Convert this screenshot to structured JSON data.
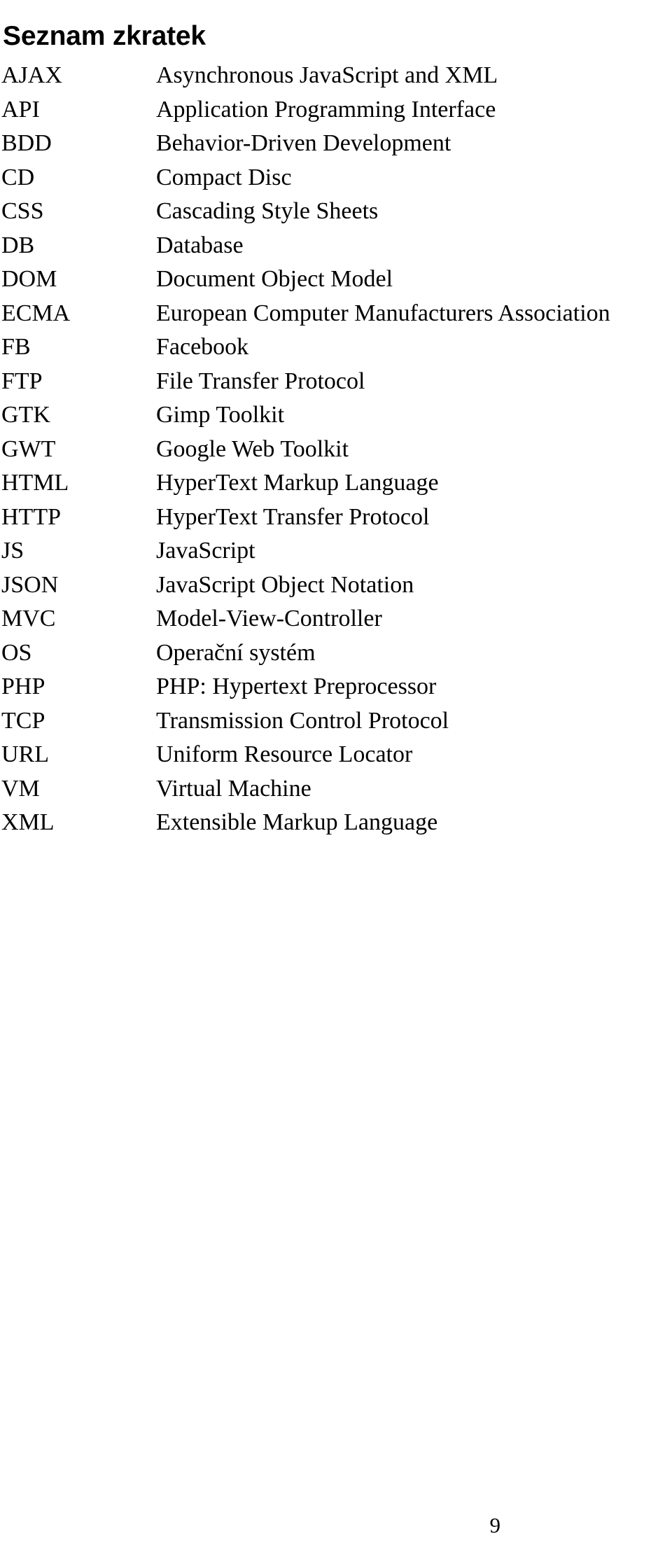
{
  "document": {
    "title": "Seznam zkratek",
    "page_number": "9"
  },
  "abbreviations": [
    {
      "term": "AJAX",
      "description": "Asynchronous JavaScript and XML"
    },
    {
      "term": "API",
      "description": "Application Programming Interface"
    },
    {
      "term": "BDD",
      "description": "Behavior-Driven Development"
    },
    {
      "term": "CD",
      "description": "Compact Disc"
    },
    {
      "term": "CSS",
      "description": "Cascading Style Sheets"
    },
    {
      "term": "DB",
      "description": "Database"
    },
    {
      "term": "DOM",
      "description": "Document Object Model"
    },
    {
      "term": "ECMA",
      "description": "European Computer Manufacturers Association"
    },
    {
      "term": "FB",
      "description": "Facebook"
    },
    {
      "term": "FTP",
      "description": "File Transfer Protocol"
    },
    {
      "term": "GTK",
      "description": "Gimp Toolkit"
    },
    {
      "term": "GWT",
      "description": "Google Web Toolkit"
    },
    {
      "term": "HTML",
      "description": "HyperText Markup Language"
    },
    {
      "term": "HTTP",
      "description": "HyperText Transfer Protocol"
    },
    {
      "term": "JS",
      "description": "JavaScript"
    },
    {
      "term": "JSON",
      "description": "JavaScript Object Notation"
    },
    {
      "term": "MVC",
      "description": "Model-View-Controller"
    },
    {
      "term": "OS",
      "description": "Operační systém"
    },
    {
      "term": "PHP",
      "description": "PHP: Hypertext Preprocessor"
    },
    {
      "term": "TCP",
      "description": "Transmission Control Protocol"
    },
    {
      "term": "URL",
      "description": "Uniform Resource Locator"
    },
    {
      "term": "VM",
      "description": "Virtual Machine"
    },
    {
      "term": "XML",
      "description": "Extensible Markup Language"
    }
  ]
}
